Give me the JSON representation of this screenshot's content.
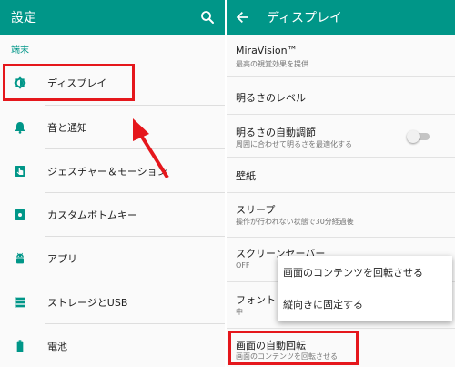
{
  "left": {
    "title": "設定",
    "section": "端末",
    "items": [
      {
        "label": "ディスプレイ",
        "icon": "brightness-icon"
      },
      {
        "label": "音と通知",
        "icon": "bell-icon"
      },
      {
        "label": "ジェスチャー＆モーション",
        "icon": "gesture-icon"
      },
      {
        "label": "カスタムボトムキー",
        "icon": "bottom-key-icon"
      },
      {
        "label": "アプリ",
        "icon": "android-icon"
      },
      {
        "label": "ストレージとUSB",
        "icon": "storage-icon"
      },
      {
        "label": "電池",
        "icon": "battery-icon"
      }
    ]
  },
  "right": {
    "title": "ディスプレイ",
    "items": [
      {
        "title": "MiraVision™",
        "subtitle": "最高の視覚効果を提供"
      },
      {
        "title": "明るさのレベル",
        "subtitle": ""
      },
      {
        "title": "明るさの自動調節",
        "subtitle": "周囲に合わせて明るさを最適化する"
      },
      {
        "title": "壁紙",
        "subtitle": ""
      },
      {
        "title": "スリープ",
        "subtitle": "操作が行われない状態で30分経過後"
      },
      {
        "title": "スクリーンセーバー",
        "subtitle": "OFF"
      },
      {
        "title": "フォント",
        "subtitle": "中"
      },
      {
        "title": "画面の自動回転",
        "subtitle": "画面のコンテンツを回転させる"
      }
    ],
    "auto_brightness_enabled": false
  },
  "popup": {
    "options": [
      "画面のコンテンツを回転させる",
      "縦向きに固定する"
    ]
  },
  "colors": {
    "appbar": "#009688",
    "accent": "#009688",
    "highlight": "#e5171c"
  }
}
